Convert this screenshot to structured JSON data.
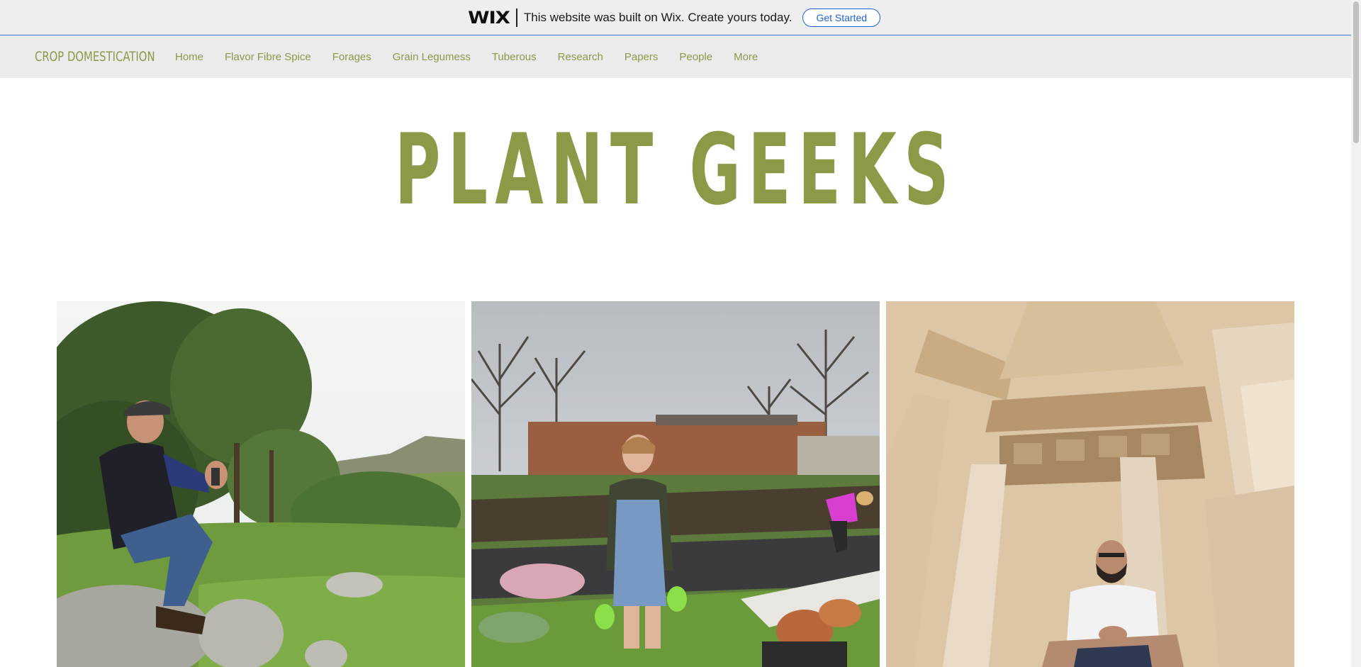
{
  "wix_banner": {
    "logo": "WIX",
    "message": "This website was built on Wix. Create yours today.",
    "button_label": "Get Started"
  },
  "nav": {
    "brand": "CROP DOMESTICATION",
    "items": [
      {
        "label": "Home"
      },
      {
        "label": "Flavor Fibre Spice"
      },
      {
        "label": "Forages"
      },
      {
        "label": "Grain Legumess"
      },
      {
        "label": "Tuberous"
      },
      {
        "label": "Research"
      },
      {
        "label": "Papers"
      },
      {
        "label": "People"
      },
      {
        "label": "More"
      }
    ]
  },
  "hero": {
    "title": "PLANT GEEKS"
  },
  "gallery": {
    "photos": [
      {
        "name": "photo-man-on-rocks"
      },
      {
        "name": "photo-woman-in-garden"
      },
      {
        "name": "photo-man-at-ruins"
      }
    ]
  },
  "colors": {
    "brand_green": "#8a9a47",
    "wix_blue": "#1f63d9",
    "banner_bg": "#eeeeee",
    "nav_bg": "#ebebeb"
  }
}
